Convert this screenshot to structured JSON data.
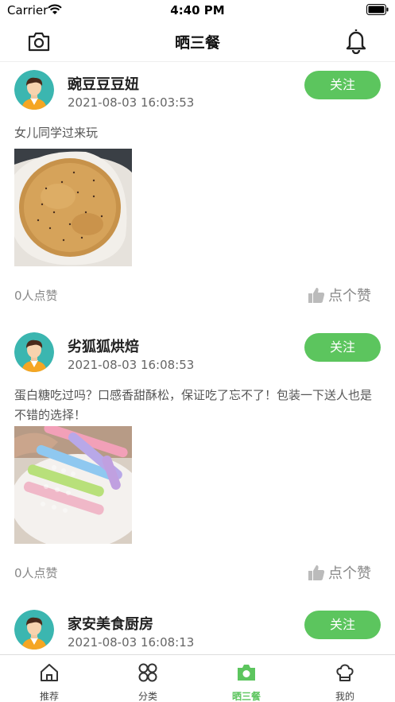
{
  "status_bar": {
    "carrier": "Carrier",
    "time": "4:40 PM"
  },
  "nav": {
    "title": "晒三餐",
    "left_icon": "camera-icon",
    "right_icon": "bell-icon"
  },
  "posts": [
    {
      "username": "豌豆豆豆妞",
      "timestamp": "2021-08-03 16:03:53",
      "follow_label": "关注",
      "text": "女儿同学过来玩",
      "image": "baked-flatbread-photo",
      "likes": "0人点赞",
      "like_label": "点个赞"
    },
    {
      "username": "劣狐狐烘焙",
      "timestamp": "2021-08-03 16:08:53",
      "follow_label": "关注",
      "text": "蛋白糖吃过吗？口感香甜酥松，保证吃了忘不了！包装一下送人也是不错的选择！",
      "image": "meringue-cookies-photo",
      "likes": "0人点赞",
      "like_label": "点个赞"
    },
    {
      "username": "家安美食厨房",
      "timestamp": "2021-08-03 16:08:13",
      "follow_label": "关注"
    }
  ],
  "tabs": [
    {
      "label": "推荐",
      "icon": "home-icon",
      "active": false
    },
    {
      "label": "分类",
      "icon": "category-icon",
      "active": false
    },
    {
      "label": "晒三餐",
      "icon": "camera-icon",
      "active": true
    },
    {
      "label": "我的",
      "icon": "chef-hat-icon",
      "active": false
    }
  ],
  "colors": {
    "accent": "#5cc55e",
    "text_secondary": "#888888"
  }
}
